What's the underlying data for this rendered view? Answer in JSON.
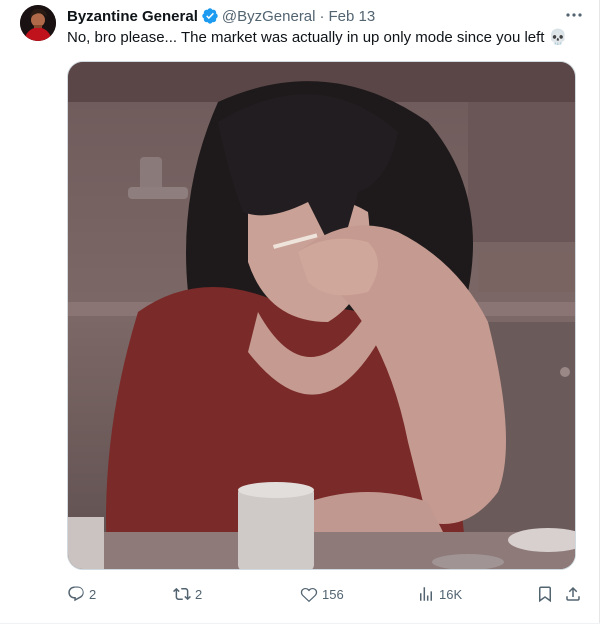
{
  "tweet": {
    "author_name": "Byzantine General",
    "author_handle": "@ByzGeneral",
    "separator": "·",
    "date": "Feb 13",
    "text": "No, bro please... The market was actually in up only mode since you left 💀"
  },
  "actions": {
    "replies": "2",
    "reposts": "2",
    "likes": "156",
    "views": "16K"
  },
  "icons": {
    "verified": "verified-badge-icon",
    "more": "more-icon",
    "reply": "reply-icon",
    "repost": "repost-icon",
    "like": "heart-icon",
    "views": "views-icon",
    "bookmark": "bookmark-icon",
    "share": "share-icon"
  },
  "colors": {
    "text_primary": "#0f1419",
    "text_secondary": "#536471",
    "verified_blue": "#1d9bf0"
  }
}
